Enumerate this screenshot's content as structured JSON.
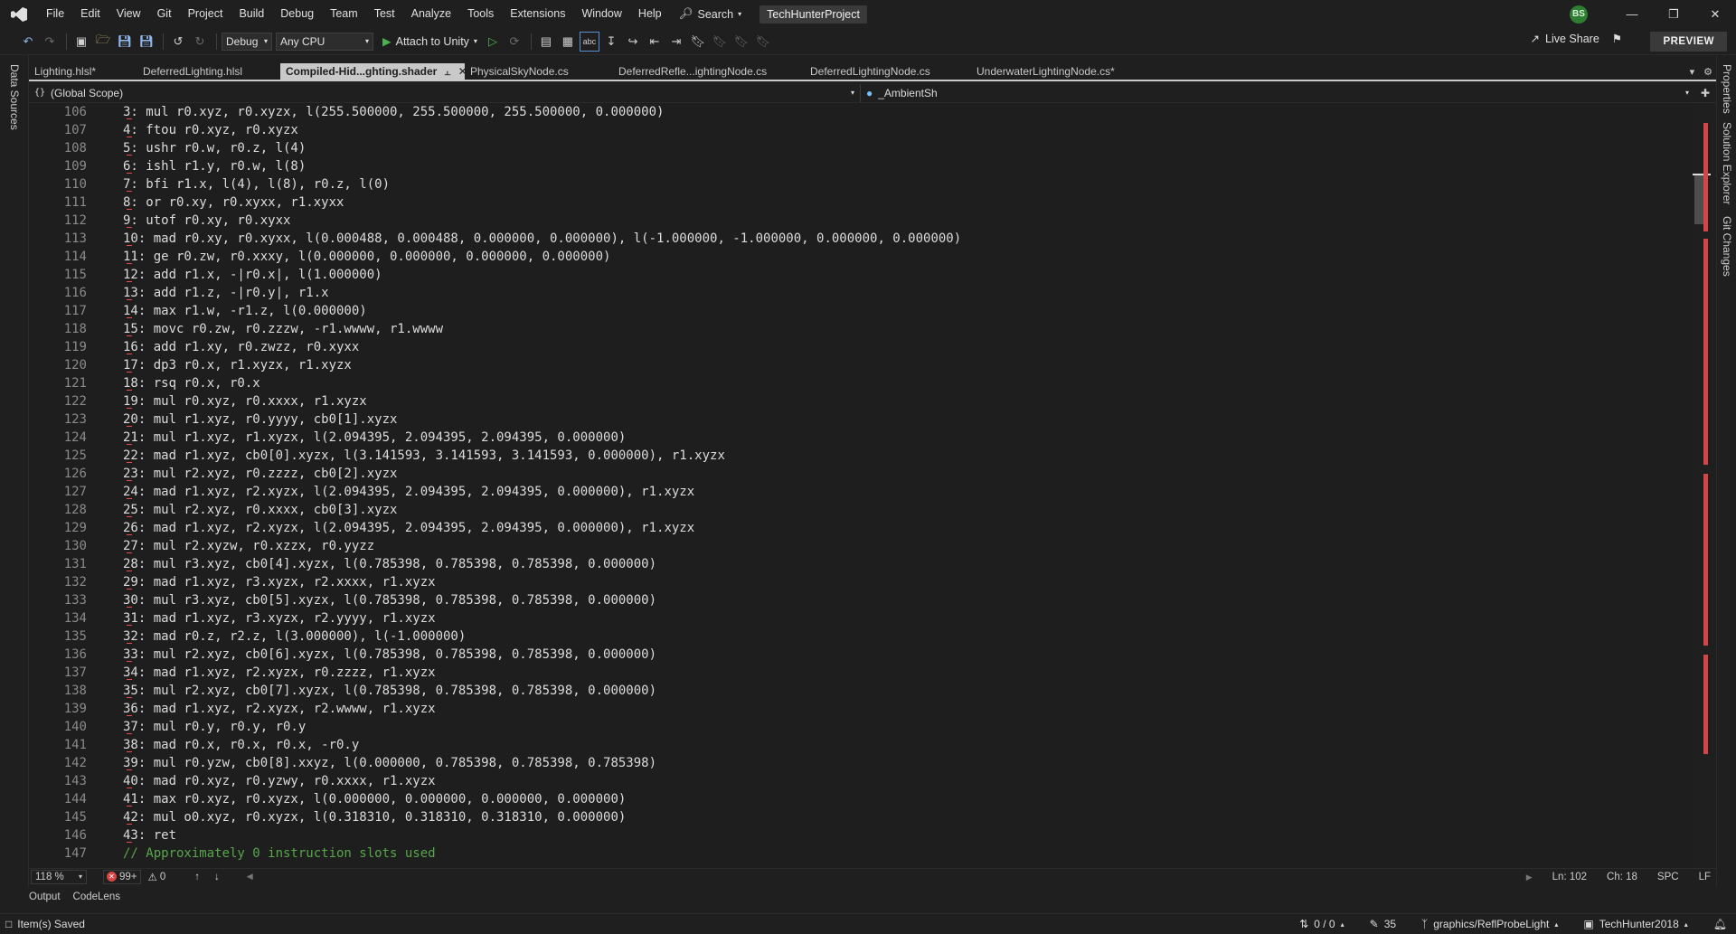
{
  "menu": {
    "items": [
      "File",
      "Edit",
      "View",
      "Git",
      "Project",
      "Build",
      "Debug",
      "Team",
      "Test",
      "Analyze",
      "Tools",
      "Extensions",
      "Window",
      "Help"
    ],
    "search_label": "Search",
    "solution_name": "TechHunterProject",
    "avatar_initials": "BS"
  },
  "toolbar": {
    "configuration": "Debug",
    "platform": "Any CPU",
    "attach_label": "Attach to Unity",
    "live_share_label": "Live Share",
    "preview_label": "PREVIEW"
  },
  "side_panels": {
    "left": "Data Sources",
    "right": [
      "Properties",
      "Solution Explorer",
      "Git Changes"
    ]
  },
  "tabs": [
    {
      "label": "Lighting.hlsl*",
      "active": false
    },
    {
      "label": "DeferredLighting.hlsl",
      "active": false
    },
    {
      "label": "Compiled-Hid...ghting.shader",
      "active": true
    },
    {
      "label": "PhysicalSkyNode.cs",
      "active": false
    },
    {
      "label": "DeferredRefle...ightingNode.cs",
      "active": false
    },
    {
      "label": "DeferredLightingNode.cs",
      "active": false
    },
    {
      "label": "UnderwaterLightingNode.cs*",
      "active": false
    }
  ],
  "navbar": {
    "scope": "(Global Scope)",
    "member": "_AmbientSh"
  },
  "code": {
    "lines": [
      {
        "num": "106",
        "text": "3: mul r0.xyz, r0.xyzx, l(255.500000, 255.500000, 255.500000, 0.000000)"
      },
      {
        "num": "107",
        "text": "4: ftou r0.xyz, r0.xyzx"
      },
      {
        "num": "108",
        "text": "5: ushr r0.w, r0.z, l(4)"
      },
      {
        "num": "109",
        "text": "6: ishl r1.y, r0.w, l(8)"
      },
      {
        "num": "110",
        "text": "7: bfi r1.x, l(4), l(8), r0.z, l(0)"
      },
      {
        "num": "111",
        "text": "8: or r0.xy, r0.xyxx, r1.xyxx"
      },
      {
        "num": "112",
        "text": "9: utof r0.xy, r0.xyxx"
      },
      {
        "num": "113",
        "text": "10: mad r0.xy, r0.xyxx, l(0.000488, 0.000488, 0.000000, 0.000000), l(-1.000000, -1.000000, 0.000000, 0.000000)"
      },
      {
        "num": "114",
        "text": "11: ge r0.zw, r0.xxxy, l(0.000000, 0.000000, 0.000000, 0.000000)"
      },
      {
        "num": "115",
        "text": "12: add r1.x, -|r0.x|, l(1.000000)"
      },
      {
        "num": "116",
        "text": "13: add r1.z, -|r0.y|, r1.x"
      },
      {
        "num": "117",
        "text": "14: max r1.w, -r1.z, l(0.000000)"
      },
      {
        "num": "118",
        "text": "15: movc r0.zw, r0.zzzw, -r1.wwww, r1.wwww"
      },
      {
        "num": "119",
        "text": "16: add r1.xy, r0.zwzz, r0.xyxx"
      },
      {
        "num": "120",
        "text": "17: dp3 r0.x, r1.xyzx, r1.xyzx"
      },
      {
        "num": "121",
        "text": "18: rsq r0.x, r0.x"
      },
      {
        "num": "122",
        "text": "19: mul r0.xyz, r0.xxxx, r1.xyzx"
      },
      {
        "num": "123",
        "text": "20: mul r1.xyz, r0.yyyy, cb0[1].xyzx"
      },
      {
        "num": "124",
        "text": "21: mul r1.xyz, r1.xyzx, l(2.094395, 2.094395, 2.094395, 0.000000)"
      },
      {
        "num": "125",
        "text": "22: mad r1.xyz, cb0[0].xyzx, l(3.141593, 3.141593, 3.141593, 0.000000), r1.xyzx"
      },
      {
        "num": "126",
        "text": "23: mul r2.xyz, r0.zzzz, cb0[2].xyzx"
      },
      {
        "num": "127",
        "text": "24: mad r1.xyz, r2.xyzx, l(2.094395, 2.094395, 2.094395, 0.000000), r1.xyzx"
      },
      {
        "num": "128",
        "text": "25: mul r2.xyz, r0.xxxx, cb0[3].xyzx"
      },
      {
        "num": "129",
        "text": "26: mad r1.xyz, r2.xyzx, l(2.094395, 2.094395, 2.094395, 0.000000), r1.xyzx"
      },
      {
        "num": "130",
        "text": "27: mul r2.xyzw, r0.xzzx, r0.yyzz"
      },
      {
        "num": "131",
        "text": "28: mul r3.xyz, cb0[4].xyzx, l(0.785398, 0.785398, 0.785398, 0.000000)"
      },
      {
        "num": "132",
        "text": "29: mad r1.xyz, r3.xyzx, r2.xxxx, r1.xyzx"
      },
      {
        "num": "133",
        "text": "30: mul r3.xyz, cb0[5].xyzx, l(0.785398, 0.785398, 0.785398, 0.000000)"
      },
      {
        "num": "134",
        "text": "31: mad r1.xyz, r3.xyzx, r2.yyyy, r1.xyzx"
      },
      {
        "num": "135",
        "text": "32: mad r0.z, r2.z, l(3.000000), l(-1.000000)"
      },
      {
        "num": "136",
        "text": "33: mul r2.xyz, cb0[6].xyzx, l(0.785398, 0.785398, 0.785398, 0.000000)"
      },
      {
        "num": "137",
        "text": "34: mad r1.xyz, r2.xyzx, r0.zzzz, r1.xyzx"
      },
      {
        "num": "138",
        "text": "35: mul r2.xyz, cb0[7].xyzx, l(0.785398, 0.785398, 0.785398, 0.000000)"
      },
      {
        "num": "139",
        "text": "36: mad r1.xyz, r2.xyzx, r2.wwww, r1.xyzx"
      },
      {
        "num": "140",
        "text": "37: mul r0.y, r0.y, r0.y"
      },
      {
        "num": "141",
        "text": "38: mad r0.x, r0.x, r0.x, -r0.y"
      },
      {
        "num": "142",
        "text": "39: mul r0.yzw, cb0[8].xxyz, l(0.000000, 0.785398, 0.785398, 0.785398)"
      },
      {
        "num": "143",
        "text": "40: mad r0.xyz, r0.yzwy, r0.xxxx, r1.xyzx"
      },
      {
        "num": "144",
        "text": "41: max r0.xyz, r0.xyzx, l(0.000000, 0.000000, 0.000000, 0.000000)"
      },
      {
        "num": "145",
        "text": "42: mul o0.xyz, r0.xyzx, l(0.318310, 0.318310, 0.318310, 0.000000)"
      },
      {
        "num": "146",
        "text": "43: ret"
      },
      {
        "num": "147",
        "text": "// Approximately 0 instruction slots used"
      }
    ]
  },
  "editor_status": {
    "zoom": "118 %",
    "errors": "99+",
    "warnings": "0",
    "line": "Ln: 102",
    "char": "Ch: 18",
    "spacing": "SPC",
    "line_ending": "LF"
  },
  "panel_tabs": [
    "Output",
    "CodeLens"
  ],
  "status_bar": {
    "message": "Item(s) Saved",
    "sync": "0 / 0",
    "pending_changes": "35",
    "branch": "graphics/ReflProbeLight",
    "repo": "TechHunter2018"
  },
  "colors": {
    "editor_background": "#1e1e1e",
    "chrome_background": "#1f1f1f",
    "comment": "#57a64a",
    "error_squiggle": "#e05050",
    "active_tab": "#c9c9c9",
    "avatar": "#2e7d32"
  }
}
